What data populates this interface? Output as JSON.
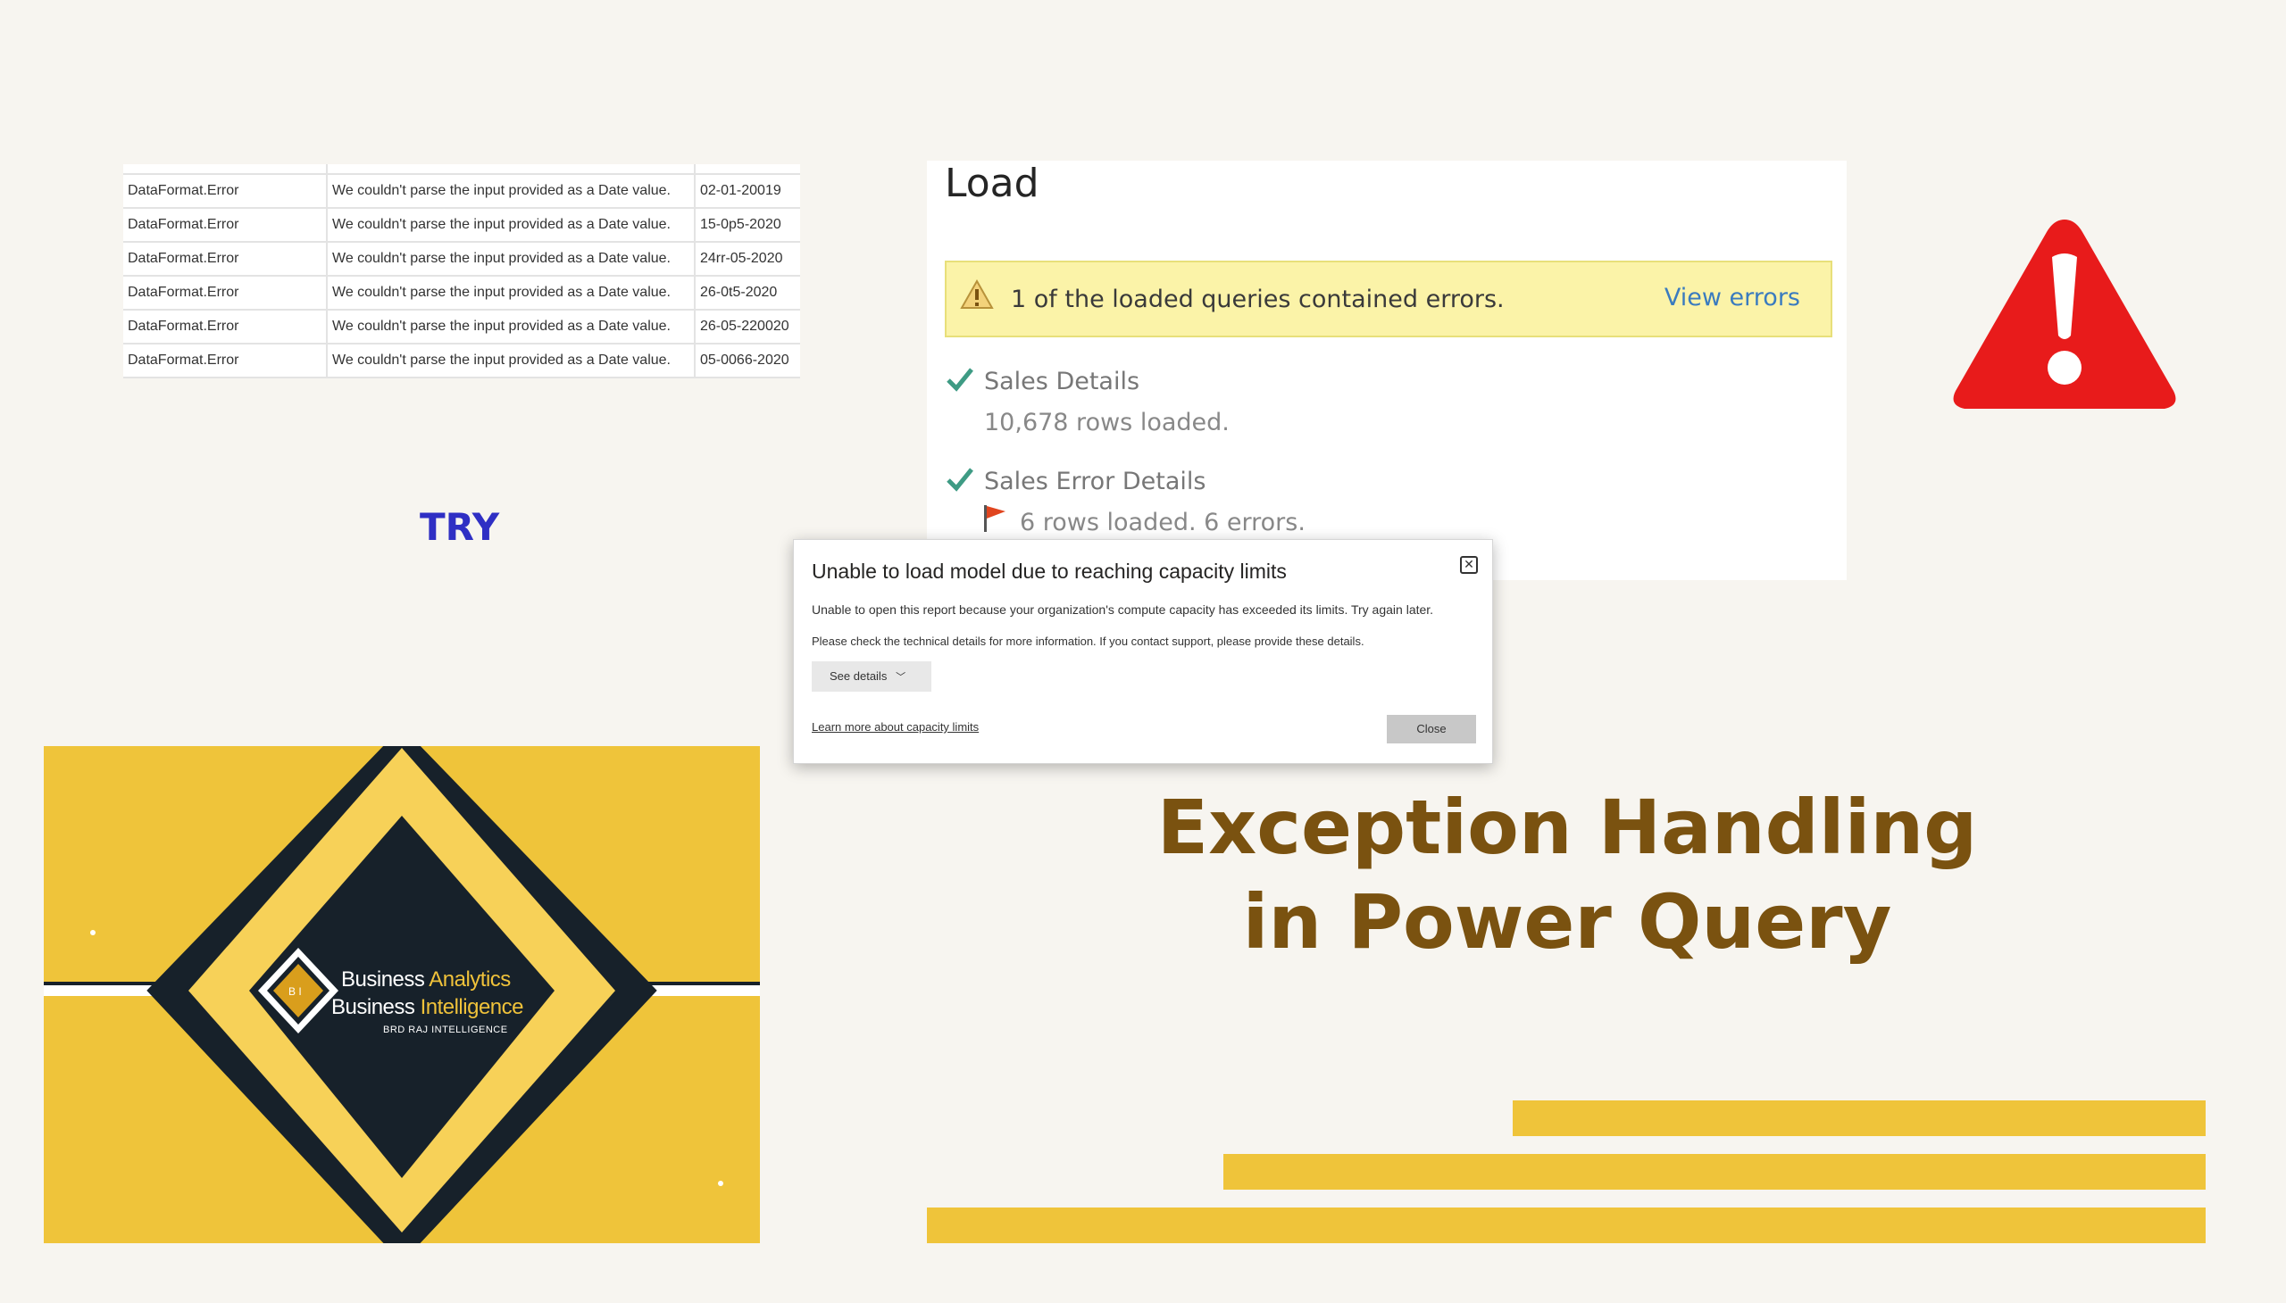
{
  "error_table": {
    "rows": [
      {
        "type": "DataFormat.Error",
        "message": "We couldn't parse the input provided as a Date value.",
        "value": "02-01-20019"
      },
      {
        "type": "DataFormat.Error",
        "message": "We couldn't parse the input provided as a Date value.",
        "value": "15-0p5-2020"
      },
      {
        "type": "DataFormat.Error",
        "message": "We couldn't parse the input provided as a Date value.",
        "value": "24rr-05-2020"
      },
      {
        "type": "DataFormat.Error",
        "message": "We couldn't parse the input provided as a Date value.",
        "value": "26-0t5-2020"
      },
      {
        "type": "DataFormat.Error",
        "message": "We couldn't parse the input provided as a Date value.",
        "value": "26-05-220020"
      },
      {
        "type": "DataFormat.Error",
        "message": "We couldn't parse the input provided as a Date value.",
        "value": "05-0066-2020"
      }
    ]
  },
  "try_label": "TRY",
  "load_panel": {
    "title": "Load",
    "warning_text": "1 of the loaded queries contained errors.",
    "view_errors_label": "View errors",
    "queries": [
      {
        "name": "Sales Details",
        "status": "10,678 rows loaded."
      },
      {
        "name": "Sales Error Details",
        "status": "6 rows loaded. 6 errors."
      }
    ]
  },
  "dialog": {
    "title": "Unable to load model due to reaching capacity limits",
    "message": "Unable to open this report because your organization's compute capacity has exceeded its limits. Try again later.",
    "details_hint": "Please check the technical details for more information. If you contact support, please provide these details.",
    "see_details_label": "See details",
    "learn_more_label": "Learn more about capacity limits",
    "close_label": "Close"
  },
  "logo": {
    "line1_a": "Business ",
    "line1_b": "Analytics",
    "line2_a": "Business ",
    "line2_b": "Intelligence",
    "sub": "BRD RAJ INTELLIGENCE",
    "badge": "B I"
  },
  "headline": {
    "line1": "Exception Handling",
    "line2": "in Power Query"
  },
  "colors": {
    "accent_yellow": "#efc43a",
    "dark_navy": "#17212a",
    "headline_brown": "#7a5210",
    "try_blue": "#2f2fc4",
    "warning_red": "#e81b1b"
  }
}
